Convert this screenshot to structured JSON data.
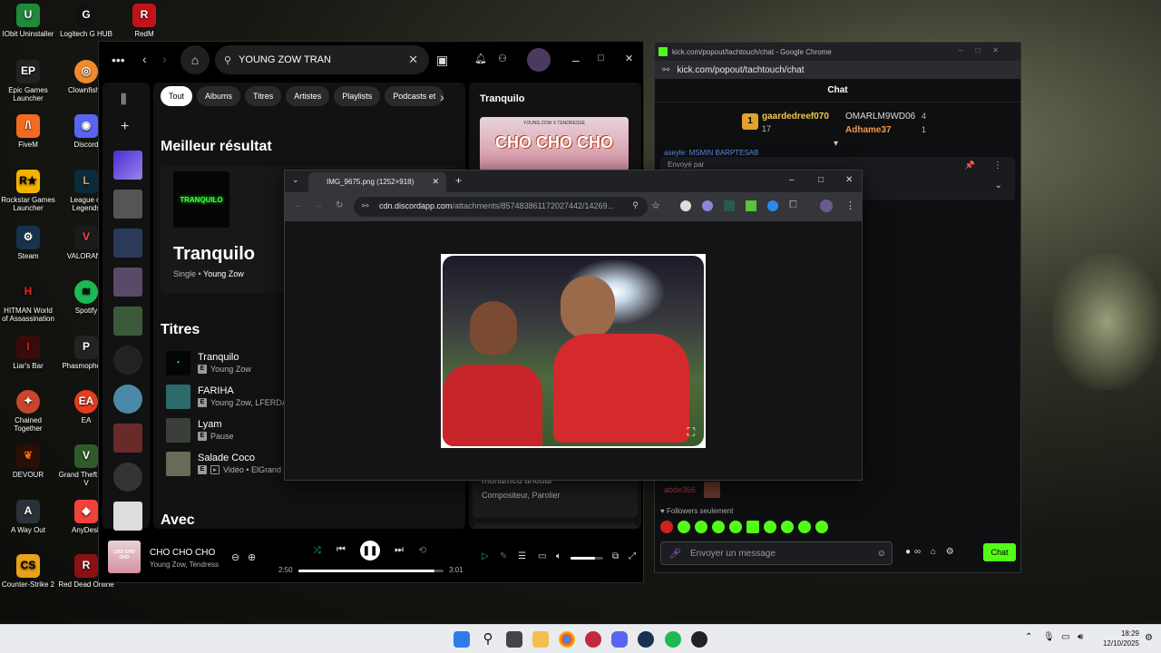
{
  "desktop": {
    "icons": [
      {
        "label": "IObit Uninstaller",
        "x": 0
      },
      {
        "label": "Logitech G HUB"
      },
      {
        "label": "RedM"
      },
      {
        "label": "Epic Games Launcher"
      },
      {
        "label": "ClownfishV"
      },
      {
        "label": "FiveM"
      },
      {
        "label": "Discord"
      },
      {
        "label": "Rockstar Games Launcher"
      },
      {
        "label": "League of Legends"
      },
      {
        "label": "Steam"
      },
      {
        "label": "VALORANT"
      },
      {
        "label": "HITMAN World of Assassination"
      },
      {
        "label": "Spotify"
      },
      {
        "label": "Liar's Bar"
      },
      {
        "label": "Phasmophobia"
      },
      {
        "label": "Chained Together"
      },
      {
        "label": "EA"
      },
      {
        "label": "DEVOUR"
      },
      {
        "label": "Grand Theft Auto V"
      },
      {
        "label": "A Way Out"
      },
      {
        "label": "AnyDesk"
      },
      {
        "label": "Counter-Strike 2"
      },
      {
        "label": "Red Dead Online"
      }
    ]
  },
  "spotify": {
    "search_value": "YOUNG ZOW TRAN",
    "filters": [
      "Tout",
      "Albums",
      "Titres",
      "Artistes",
      "Playlists",
      "Podcasts et"
    ],
    "best_result_heading": "Meilleur résultat",
    "best_result": {
      "cover_text": "TRANQUILO",
      "title": "Tranquilo",
      "type": "Single",
      "artist": "Young Zow"
    },
    "tracks_heading": "Titres",
    "tracks": [
      {
        "title": "Tranquilo",
        "artist": "Young Zow"
      },
      {
        "title": "FARIHA",
        "artist": "Young Zow, LFERDA"
      },
      {
        "title": "Lyam",
        "artist": "Pause"
      },
      {
        "title": "Salade Coco",
        "artist": "Vidéo • ElGrand"
      }
    ],
    "with_heading": "Avec",
    "right_panel": {
      "title": "Tranquilo",
      "cover_top": "YOUNG ZOW X TENDRESSE",
      "cover_big": "CHO CHO CHO",
      "credit_name": "mohamed anouar",
      "credit_role": "Compositeur, Parolier"
    },
    "player": {
      "cover_text": "CHO CHO CHO",
      "title": "CHO CHO CHO",
      "artist": "Young Zow, Tendress",
      "elapsed": "2:50",
      "duration": "3:01",
      "progress": 0.94,
      "volume": 0.75
    }
  },
  "kick": {
    "window_title": "kick.com/popout/tachtouch/chat - Google Chrome",
    "url": "kick.com/popout/tachtouch/chat",
    "header": "Chat",
    "leaderboard": [
      {
        "rank": "1",
        "name": "gaardedreef070",
        "count": "17"
      },
      {
        "name": "OMARLM9WD06",
        "count": "4"
      },
      {
        "name": "Adhame37",
        "count": "1"
      }
    ],
    "partial_line": "aseyle: MSMIN BARPTESAB",
    "pinned_label": "Envoyé par",
    "chat_user": "abde366",
    "followers_only": "Followers seulement",
    "input_placeholder": "Envoyer un message",
    "chat_button": "Chat"
  },
  "viewer": {
    "tab_title": "IMG_9675.png (1252×918)",
    "url_host": "cdn.discordapp.com",
    "url_path": "/attachments/857483861172027442/14269..."
  },
  "taskbar": {
    "time": "18:29",
    "date": "12/10/2025"
  }
}
